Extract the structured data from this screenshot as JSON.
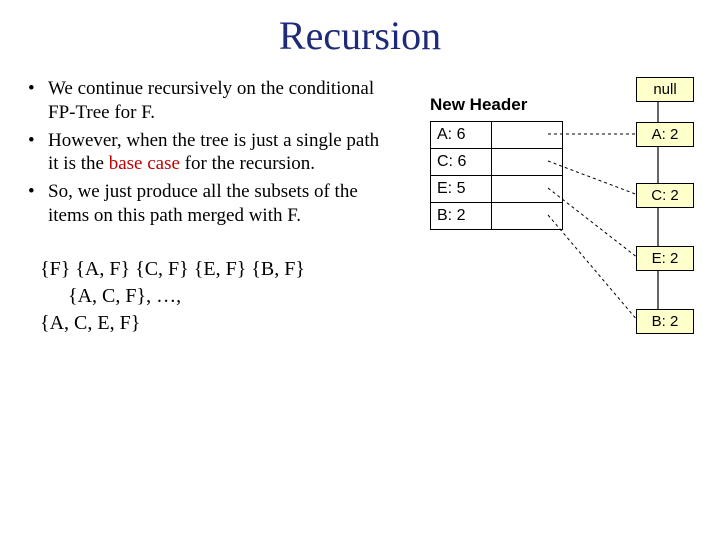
{
  "title": "Recursion",
  "bullets": {
    "b1": "We continue recursively on the conditional FP-Tree for F.",
    "b2a": "However, when the tree is just a single path it is the ",
    "b2_base": "base case",
    "b2b": " for the recursion.",
    "b3": "So, we just produce all the subsets of the items on this path merged with F."
  },
  "subsets": {
    "line1": "{F} {A, F} {C, F} {E, F} {B, F}",
    "line2": "{A, C, F}, …,",
    "line3": "{A, C, E, F}"
  },
  "header_label": "New Header",
  "header_rows": {
    "r0": "A: 6",
    "r1": "C: 6",
    "r2": "E: 5",
    "r3": "B: 2"
  },
  "tree_nodes": {
    "null": "null",
    "a": "A: 2",
    "c": "C: 2",
    "e": "E: 2",
    "b": "B: 2"
  }
}
